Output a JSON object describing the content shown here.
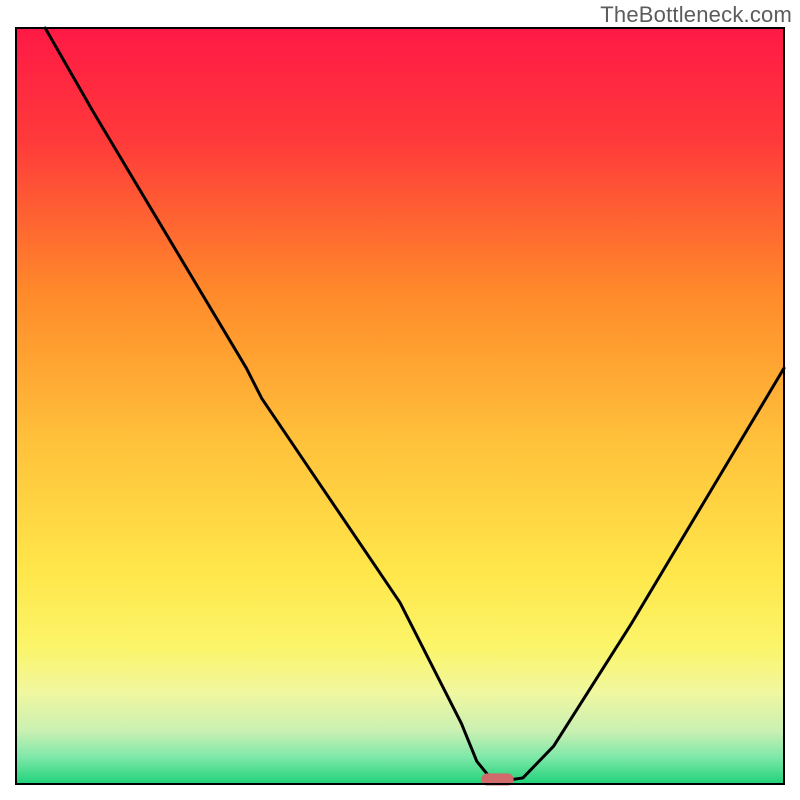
{
  "watermark": "TheBottleneck.com",
  "chart_data": {
    "type": "line",
    "title": "",
    "xlabel": "",
    "ylabel": "",
    "xlim": [
      0,
      100
    ],
    "ylim": [
      0,
      100
    ],
    "gradient_background": {
      "description": "Vertical gradient from red at top through orange and yellow to green at bottom",
      "stops": [
        {
          "offset": 0.0,
          "color": "#ff1946"
        },
        {
          "offset": 0.15,
          "color": "#ff3a3a"
        },
        {
          "offset": 0.35,
          "color": "#ff8a2a"
        },
        {
          "offset": 0.55,
          "color": "#ffc23b"
        },
        {
          "offset": 0.72,
          "color": "#ffe74a"
        },
        {
          "offset": 0.82,
          "color": "#fbf56a"
        },
        {
          "offset": 0.88,
          "color": "#f0f7a0"
        },
        {
          "offset": 0.93,
          "color": "#c9f0b2"
        },
        {
          "offset": 0.965,
          "color": "#7de8a9"
        },
        {
          "offset": 1.0,
          "color": "#1fd179"
        }
      ]
    },
    "series": [
      {
        "name": "bottleneck-curve",
        "color": "#000000",
        "x": [
          3.8,
          10,
          20,
          30,
          32,
          40,
          50,
          58,
          60,
          62,
          64,
          66,
          70,
          80,
          90,
          100
        ],
        "y": [
          100,
          89,
          72,
          55,
          51,
          39,
          24,
          8,
          3,
          0.5,
          0.5,
          0.8,
          5,
          21,
          38,
          55
        ]
      }
    ],
    "marker": {
      "name": "optimal-point",
      "shape": "rounded-rect",
      "color": "#d16a6a",
      "x_center": 62.7,
      "y_center": 0.6,
      "width": 4.2,
      "height": 1.6
    },
    "border": {
      "color": "#000000",
      "width": 2
    }
  }
}
